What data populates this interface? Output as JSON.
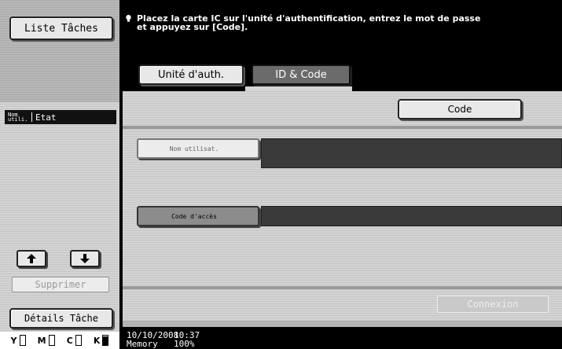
{
  "left": {
    "job_list": "Liste Tâches",
    "column_user": "Nom utili.",
    "column_status": "Etat",
    "delete": "Supprimer",
    "job_details": "Détails Tâche",
    "up_icon": "arrow-up-icon",
    "down_icon": "arrow-down-icon"
  },
  "toner": [
    {
      "label": "Y",
      "level": 0.0
    },
    {
      "label": "M",
      "level": 0.0
    },
    {
      "label": "C",
      "level": 0.0
    },
    {
      "label": "K",
      "level": 0.9
    }
  ],
  "message": {
    "icon": "lightbulb-icon",
    "line1": "Placez la carte IC sur l'unité d'authentification, entrez le mot de passe",
    "line2": "et appuyez sur [Code]."
  },
  "tabs": {
    "auth_unit": "Unité d'auth.",
    "id_code": "ID & Code",
    "selected": "ID & Code"
  },
  "content": {
    "code_button": "Code",
    "user_name_label": "Nom utilisat.",
    "user_name_value": "",
    "access_code_label": "Code d'accès",
    "access_code_value": "",
    "login_button": "Connexion"
  },
  "status": {
    "date": "10/10/2008",
    "time": "10:37",
    "memory_label": "Memory",
    "memory_value": "100%"
  },
  "colors": {
    "background": "#000000",
    "panel": "#d4d4d4",
    "field": "#3a3a3a",
    "selected_tab": "#6b6b6b"
  }
}
